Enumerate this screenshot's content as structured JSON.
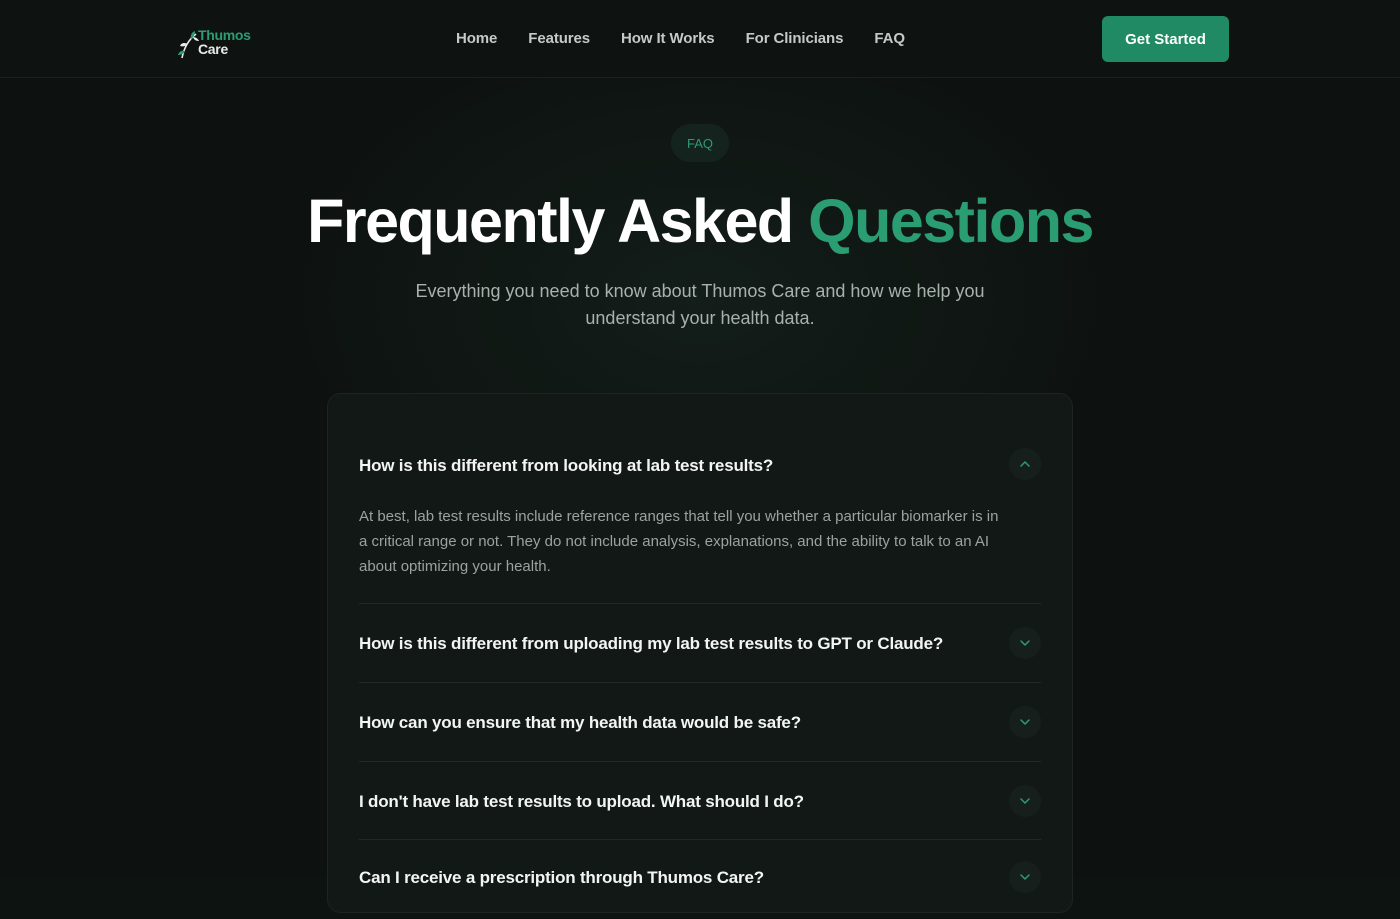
{
  "brand": {
    "name_line1": "Thumos",
    "name_line2": "Care",
    "accent": "#2a9d73"
  },
  "nav": {
    "links": [
      "Home",
      "Features",
      "How It Works",
      "For Clinicians",
      "FAQ"
    ],
    "cta": "Get Started"
  },
  "hero": {
    "pill": "FAQ",
    "title_main": "Frequently Asked ",
    "title_accent": "Questions",
    "subtitle": "Everything you need to know about Thumos Care and how we help you understand your health data."
  },
  "faq": {
    "items": [
      {
        "question": "How is this different from looking at lab test results?",
        "answer": "At best, lab test results include reference ranges that tell you whether a particular biomarker is in a critical range or not. They do not include analysis, explanations, and the ability to talk to an AI about optimizing your health.",
        "expanded": true
      },
      {
        "question": "How is this different from uploading my lab test results to GPT or Claude?",
        "expanded": false
      },
      {
        "question": "How can you ensure that my health data would be safe?",
        "expanded": false
      },
      {
        "question": "I don't have lab test results to upload. What should I do?",
        "expanded": false
      },
      {
        "question": "Can I receive a prescription through Thumos Care?",
        "expanded": false
      }
    ]
  }
}
